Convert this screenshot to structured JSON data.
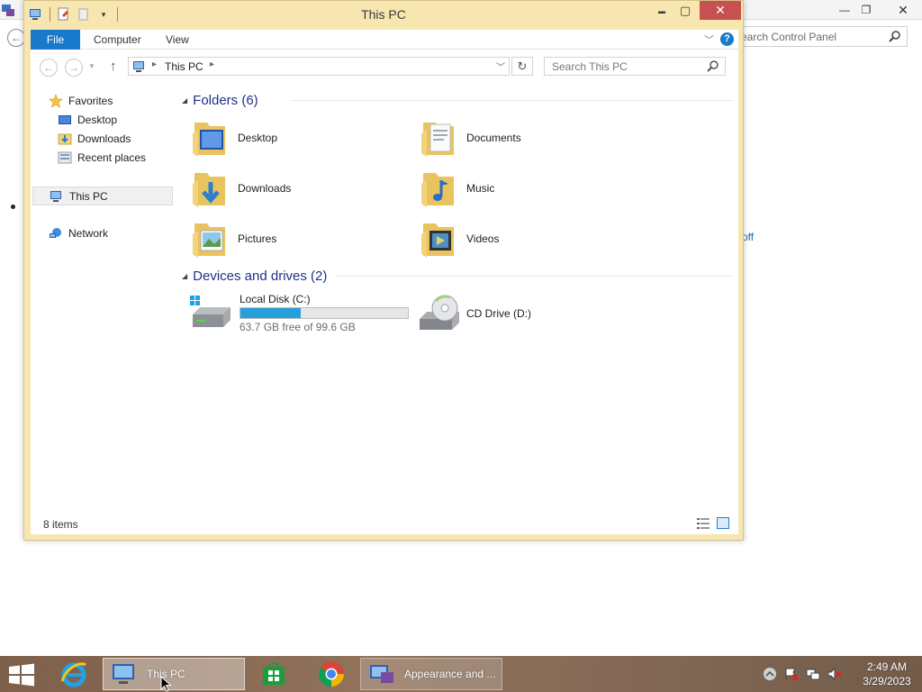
{
  "background_window": {
    "search_placeholder": "earch Control Panel",
    "partial_link": "off"
  },
  "explorer": {
    "title": "This PC",
    "controls": {
      "minimize": "▬",
      "maximize": "▢",
      "close": "✕"
    },
    "ribbon": {
      "tabs": [
        "File",
        "Computer",
        "View"
      ],
      "help": "?"
    },
    "address": {
      "path": "This PC",
      "search_placeholder": "Search This PC"
    },
    "nav_pane": {
      "favorites": "Favorites",
      "desktop": "Desktop",
      "downloads": "Downloads",
      "recent_places": "Recent places",
      "this_pc": "This PC",
      "network": "Network"
    },
    "folders_header": "Folders (6)",
    "folders": [
      {
        "name": "Desktop",
        "icon": "desktop-folder-icon"
      },
      {
        "name": "Documents",
        "icon": "documents-folder-icon"
      },
      {
        "name": "Downloads",
        "icon": "downloads-folder-icon"
      },
      {
        "name": "Music",
        "icon": "music-folder-icon"
      },
      {
        "name": "Pictures",
        "icon": "pictures-folder-icon"
      },
      {
        "name": "Videos",
        "icon": "videos-folder-icon"
      }
    ],
    "drives_header": "Devices and drives (2)",
    "drives": [
      {
        "name": "Local Disk (C:)",
        "free_text": "63.7 GB free of 99.6 GB",
        "used_fraction": 0.36
      },
      {
        "name": "CD Drive (D:)"
      }
    ],
    "status": "8 items"
  },
  "taskbar": {
    "buttons": [
      {
        "label": "This PC",
        "icon": "computer-icon"
      },
      {
        "label": "Appearance and ...",
        "icon": "control-panel-icon"
      }
    ],
    "clock": {
      "time": "2:49 AM",
      "date": "3/29/2023"
    }
  },
  "colors": {
    "window_frame": "#f7e6b0",
    "accent": "#1979ca",
    "close_button": "#c75050",
    "drive_bar": "#26a0da",
    "group_header": "#1e3287"
  }
}
